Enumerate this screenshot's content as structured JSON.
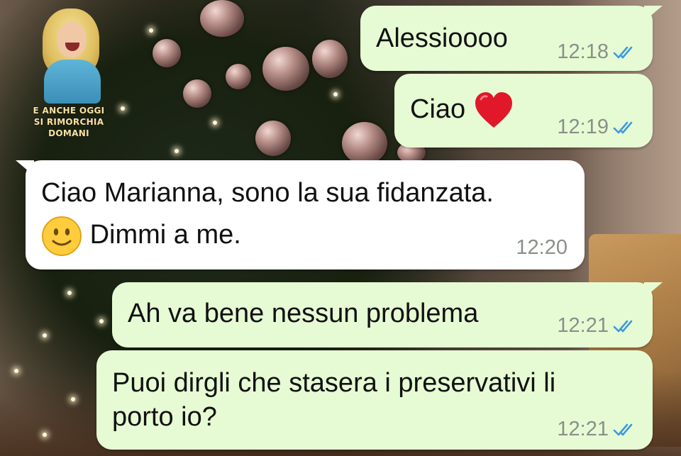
{
  "watermark": {
    "line1": "E ANCHE OGGI",
    "line2": "SI RIMORCHIA DOMANI"
  },
  "colors": {
    "outgoing_bubble": "#e6fbd3",
    "incoming_bubble": "#ffffff",
    "read_ticks": "#3b9be0",
    "timestamp": "#8a8f8a"
  },
  "messages": [
    {
      "direction": "outgoing",
      "text": "Alessioooo",
      "time": "12:18",
      "status": "read"
    },
    {
      "direction": "outgoing",
      "text": "Ciao",
      "emoji": "red-heart",
      "time": "12:19",
      "status": "read"
    },
    {
      "direction": "incoming",
      "line1": "Ciao Marianna, sono la sua fidanzata.",
      "emoji": "slightly-smiling-face",
      "line2": "Dimmi a me.",
      "time": "12:20"
    },
    {
      "direction": "outgoing",
      "text": "Ah va bene nessun problema",
      "time": "12:21",
      "status": "read"
    },
    {
      "direction": "outgoing",
      "line1": "Puoi dirgli che stasera i preservativi li",
      "line2": "porto io?",
      "time": "12:21",
      "status": "read"
    }
  ]
}
